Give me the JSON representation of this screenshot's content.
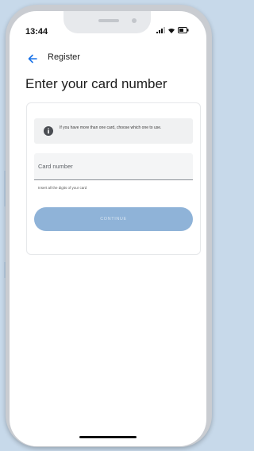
{
  "status_bar": {
    "time": "13:44",
    "icons": [
      "signal-icon",
      "wifi-icon",
      "battery-icon"
    ]
  },
  "nav": {
    "back_icon": "arrow-left-icon",
    "title": "Register"
  },
  "page": {
    "title": "Enter your card number"
  },
  "info": {
    "icon": "info-icon",
    "text": "If you have more than one card, choose which one to use."
  },
  "card_number": {
    "placeholder": "Card number",
    "value": "",
    "helper": "Insert all the digits of your card"
  },
  "actions": {
    "continue_label": "CONTINUE"
  },
  "colors": {
    "accent": "#1a73e8",
    "button_disabled": "#8fb3d8",
    "background": "#c7d9ea"
  }
}
